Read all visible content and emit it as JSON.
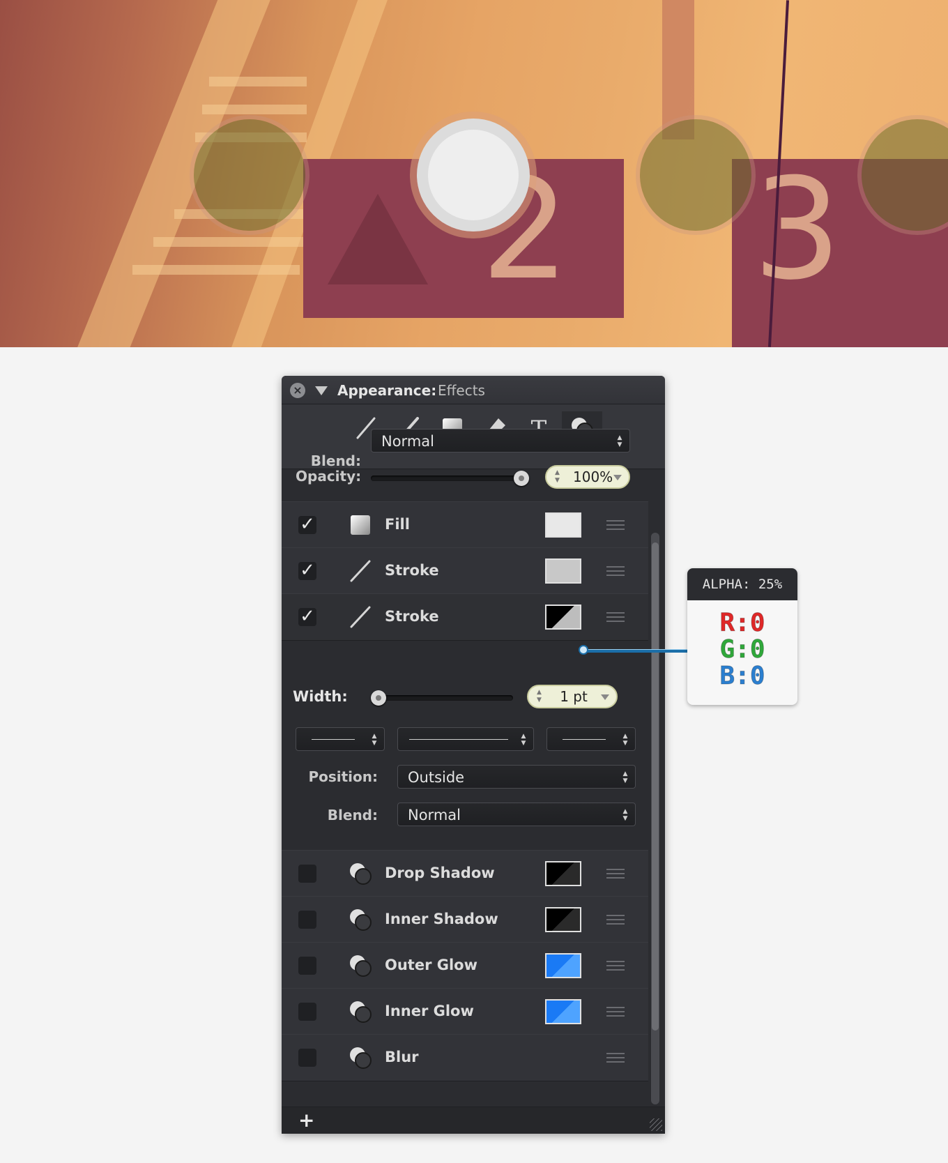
{
  "panel": {
    "title_label": "Appearance:",
    "title_value": "Effects",
    "toolbar_icons": [
      "pen-icon",
      "brush-icon",
      "square-icon",
      "eraser-icon",
      "text-icon",
      "effects-icon"
    ],
    "blend_label": "Blend:",
    "blend_value": "Normal",
    "opacity_label": "Opacity:",
    "opacity_value": "100%",
    "opacity_level": 1.0,
    "rows_top": [
      {
        "label": "Fill",
        "checked": true,
        "icon": "fill-square-icon",
        "swatch": "#e8e8e8"
      },
      {
        "label": "Stroke",
        "checked": true,
        "icon": "stroke-line-icon",
        "swatch": "#c8c8c8"
      },
      {
        "label": "Stroke",
        "checked": true,
        "icon": "stroke-line-icon",
        "swatch": "black-diagonal"
      }
    ],
    "stroke_detail": {
      "width_label": "Width:",
      "width_value": "1 pt",
      "width_level": 0.0,
      "position_label": "Position:",
      "position_value": "Outside",
      "blend_label": "Blend:",
      "blend_value": "Normal"
    },
    "rows_bottom": [
      {
        "label": "Drop Shadow",
        "checked": false,
        "swatch": "black-diagonal"
      },
      {
        "label": "Inner Shadow",
        "checked": false,
        "swatch": "black-diagonal"
      },
      {
        "label": "Outer Glow",
        "checked": false,
        "swatch": "blue-diagonal"
      },
      {
        "label": "Inner Glow",
        "checked": false,
        "swatch": "blue-diagonal"
      },
      {
        "label": "Blur",
        "checked": false,
        "swatch": null
      }
    ],
    "add_label": "+"
  },
  "callout": {
    "alpha": "ALPHA: 25%",
    "r": "R:0",
    "g": "G:0",
    "b": "B:0",
    "colors": {
      "r": "#e02828",
      "g": "#2fa83a",
      "b": "#2b7fd0"
    }
  },
  "hero": {
    "numbers": [
      "2",
      "3"
    ]
  }
}
